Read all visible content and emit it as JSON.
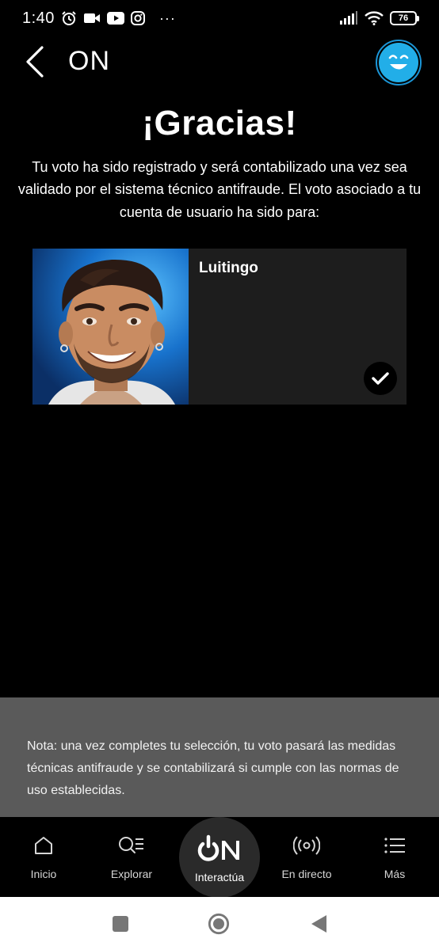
{
  "status_bar": {
    "time": "1:40",
    "more": "···",
    "battery": "76"
  },
  "header": {
    "title": "ON"
  },
  "main": {
    "title": "¡Gracias!",
    "message": "Tu voto ha sido registrado y será contabilizado una vez sea validado por el sistema técnico antifraude. El voto asociado a tu cuenta de usuario ha sido para:",
    "vote": {
      "candidate_name": "Luitingo"
    }
  },
  "note": {
    "text": "Nota: una vez completes tu selección, tu voto pasará las medidas técnicas antifraude y se contabilizará si cumple con las normas de uso establecidas."
  },
  "bottom_nav": {
    "items": [
      {
        "label": "Inicio",
        "icon": "home-icon"
      },
      {
        "label": "Explorar",
        "icon": "explore-icon"
      },
      {
        "label": "Interactúa",
        "icon": "on-logo-icon"
      },
      {
        "label": "En directo",
        "icon": "live-icon"
      },
      {
        "label": "Más",
        "icon": "menu-icon"
      }
    ]
  },
  "colors": {
    "background": "#000000",
    "card": "#1d1d1d",
    "note_panel": "#5a5a5a",
    "avatar_accent": "#22aee8"
  }
}
